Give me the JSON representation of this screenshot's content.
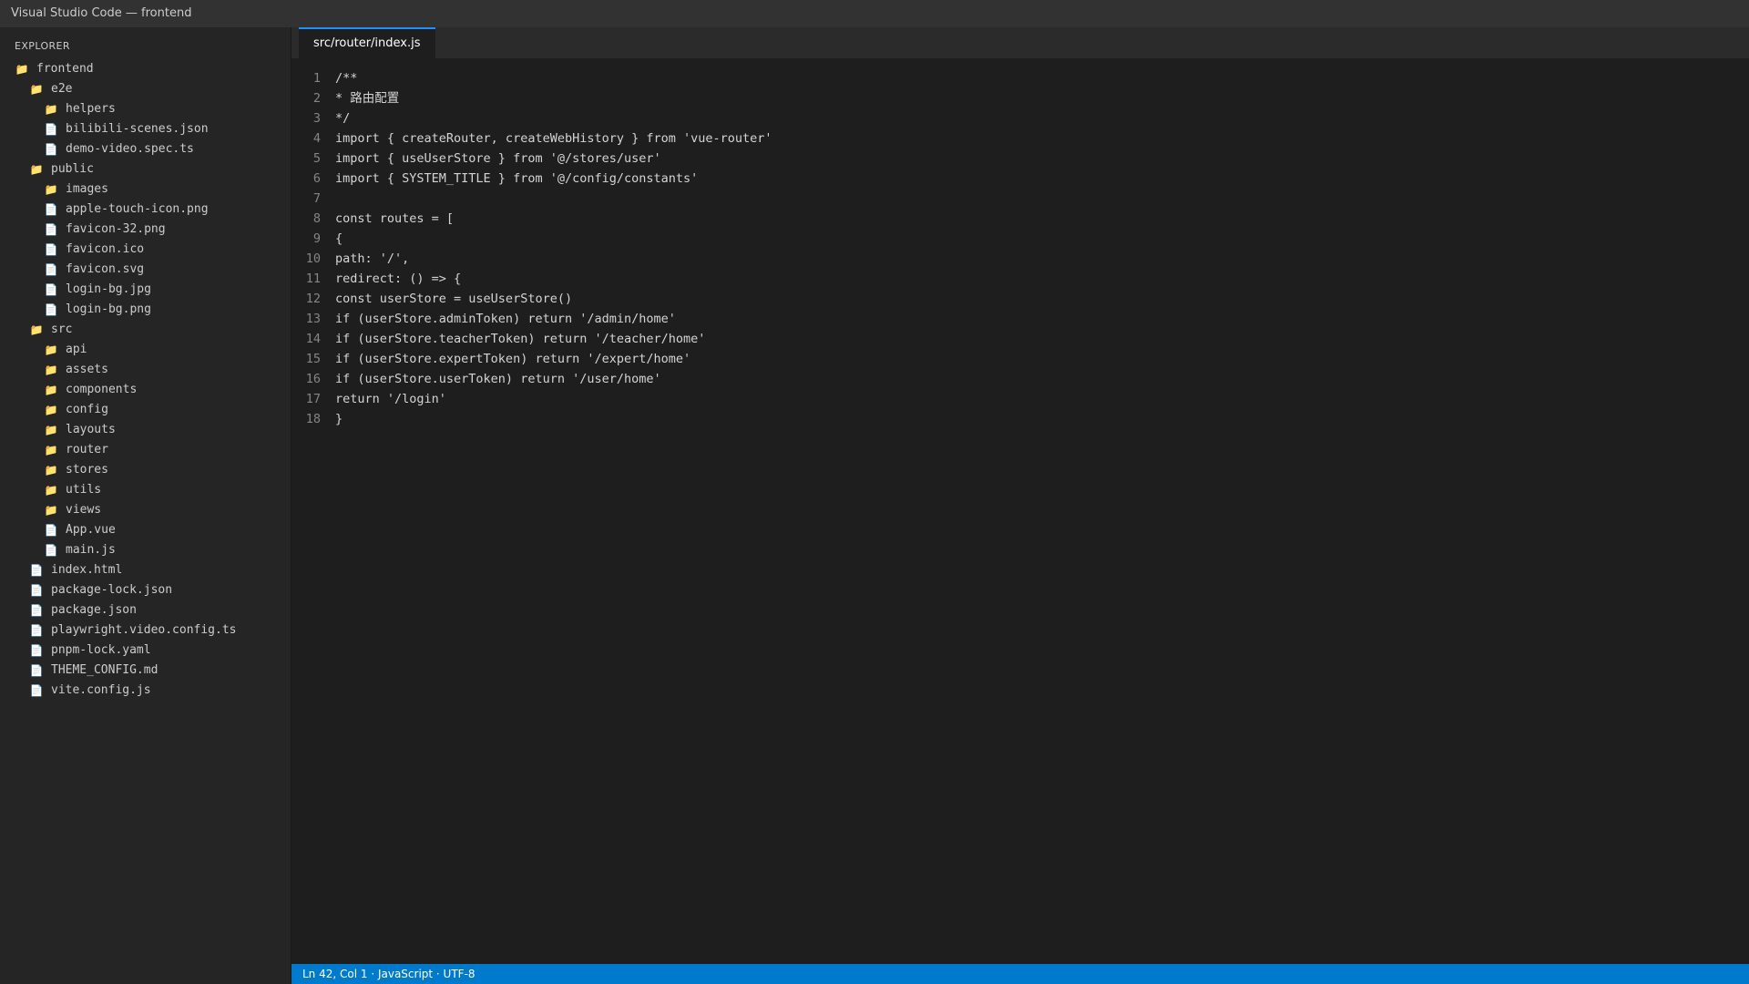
{
  "window": {
    "title": "Visual Studio Code — frontend"
  },
  "sidebar": {
    "header": "EXPLORER",
    "items": [
      {
        "label": "frontend",
        "type": "folder",
        "depth": 0
      },
      {
        "label": "e2e",
        "type": "folder",
        "depth": 1
      },
      {
        "label": "helpers",
        "type": "folder",
        "depth": 2
      },
      {
        "label": "bilibili-scenes.json",
        "type": "file",
        "depth": 2
      },
      {
        "label": "demo-video.spec.ts",
        "type": "file",
        "depth": 2
      },
      {
        "label": "public",
        "type": "folder",
        "depth": 1
      },
      {
        "label": "images",
        "type": "folder",
        "depth": 2
      },
      {
        "label": "apple-touch-icon.png",
        "type": "file",
        "depth": 2
      },
      {
        "label": "favicon-32.png",
        "type": "file",
        "depth": 2
      },
      {
        "label": "favicon.ico",
        "type": "file",
        "depth": 2
      },
      {
        "label": "favicon.svg",
        "type": "file",
        "depth": 2
      },
      {
        "label": "login-bg.jpg",
        "type": "file",
        "depth": 2
      },
      {
        "label": "login-bg.png",
        "type": "file",
        "depth": 2
      },
      {
        "label": "src",
        "type": "folder",
        "depth": 1
      },
      {
        "label": "api",
        "type": "folder",
        "depth": 2
      },
      {
        "label": "assets",
        "type": "folder",
        "depth": 2
      },
      {
        "label": "components",
        "type": "folder",
        "depth": 2
      },
      {
        "label": "config",
        "type": "folder",
        "depth": 2
      },
      {
        "label": "layouts",
        "type": "folder",
        "depth": 2
      },
      {
        "label": "router",
        "type": "folder",
        "depth": 2
      },
      {
        "label": "stores",
        "type": "folder",
        "depth": 2
      },
      {
        "label": "utils",
        "type": "folder",
        "depth": 2
      },
      {
        "label": "views",
        "type": "folder",
        "depth": 2
      },
      {
        "label": "App.vue",
        "type": "file",
        "depth": 2
      },
      {
        "label": "main.js",
        "type": "file",
        "depth": 2
      },
      {
        "label": "index.html",
        "type": "file",
        "depth": 1
      },
      {
        "label": "package-lock.json",
        "type": "file",
        "depth": 1
      },
      {
        "label": "package.json",
        "type": "file",
        "depth": 1
      },
      {
        "label": "playwright.video.config.ts",
        "type": "file",
        "depth": 1
      },
      {
        "label": "pnpm-lock.yaml",
        "type": "file",
        "depth": 1
      },
      {
        "label": "THEME_CONFIG.md",
        "type": "file",
        "depth": 1
      },
      {
        "label": "vite.config.js",
        "type": "file",
        "depth": 1
      }
    ]
  },
  "editor": {
    "tab": {
      "label": "src/router/index.js"
    },
    "lines": [
      {
        "n": "1",
        "text": "/**"
      },
      {
        "n": "2",
        "text": "* 路由配置"
      },
      {
        "n": "3",
        "text": "*/"
      },
      {
        "n": "4",
        "text": "import { createRouter, createWebHistory } from 'vue-router'"
      },
      {
        "n": "5",
        "text": "import { useUserStore } from '@/stores/user'"
      },
      {
        "n": "6",
        "text": "import { SYSTEM_TITLE } from '@/config/constants'"
      },
      {
        "n": "7",
        "text": ""
      },
      {
        "n": "8",
        "text": "const routes = ["
      },
      {
        "n": "9",
        "text": "{"
      },
      {
        "n": "10",
        "text": "path: '/',"
      },
      {
        "n": "11",
        "text": "redirect: () => {"
      },
      {
        "n": "12",
        "text": "const userStore = useUserStore()"
      },
      {
        "n": "13",
        "text": "if (userStore.adminToken) return '/admin/home'"
      },
      {
        "n": "14",
        "text": "if (userStore.teacherToken) return '/teacher/home'"
      },
      {
        "n": "15",
        "text": "if (userStore.expertToken) return '/expert/home'"
      },
      {
        "n": "16",
        "text": "if (userStore.userToken) return '/user/home'"
      },
      {
        "n": "17",
        "text": "return '/login'"
      },
      {
        "n": "18",
        "text": "}"
      }
    ]
  },
  "statusbar": {
    "text": "Ln 42, Col 1 · JavaScript · UTF-8"
  },
  "icons": {
    "folder": "folder-icon",
    "file": "file-icon"
  },
  "colors": {
    "accent": "#007acc",
    "tab_border": "#1e90ff",
    "folder": "#e8b23c"
  }
}
